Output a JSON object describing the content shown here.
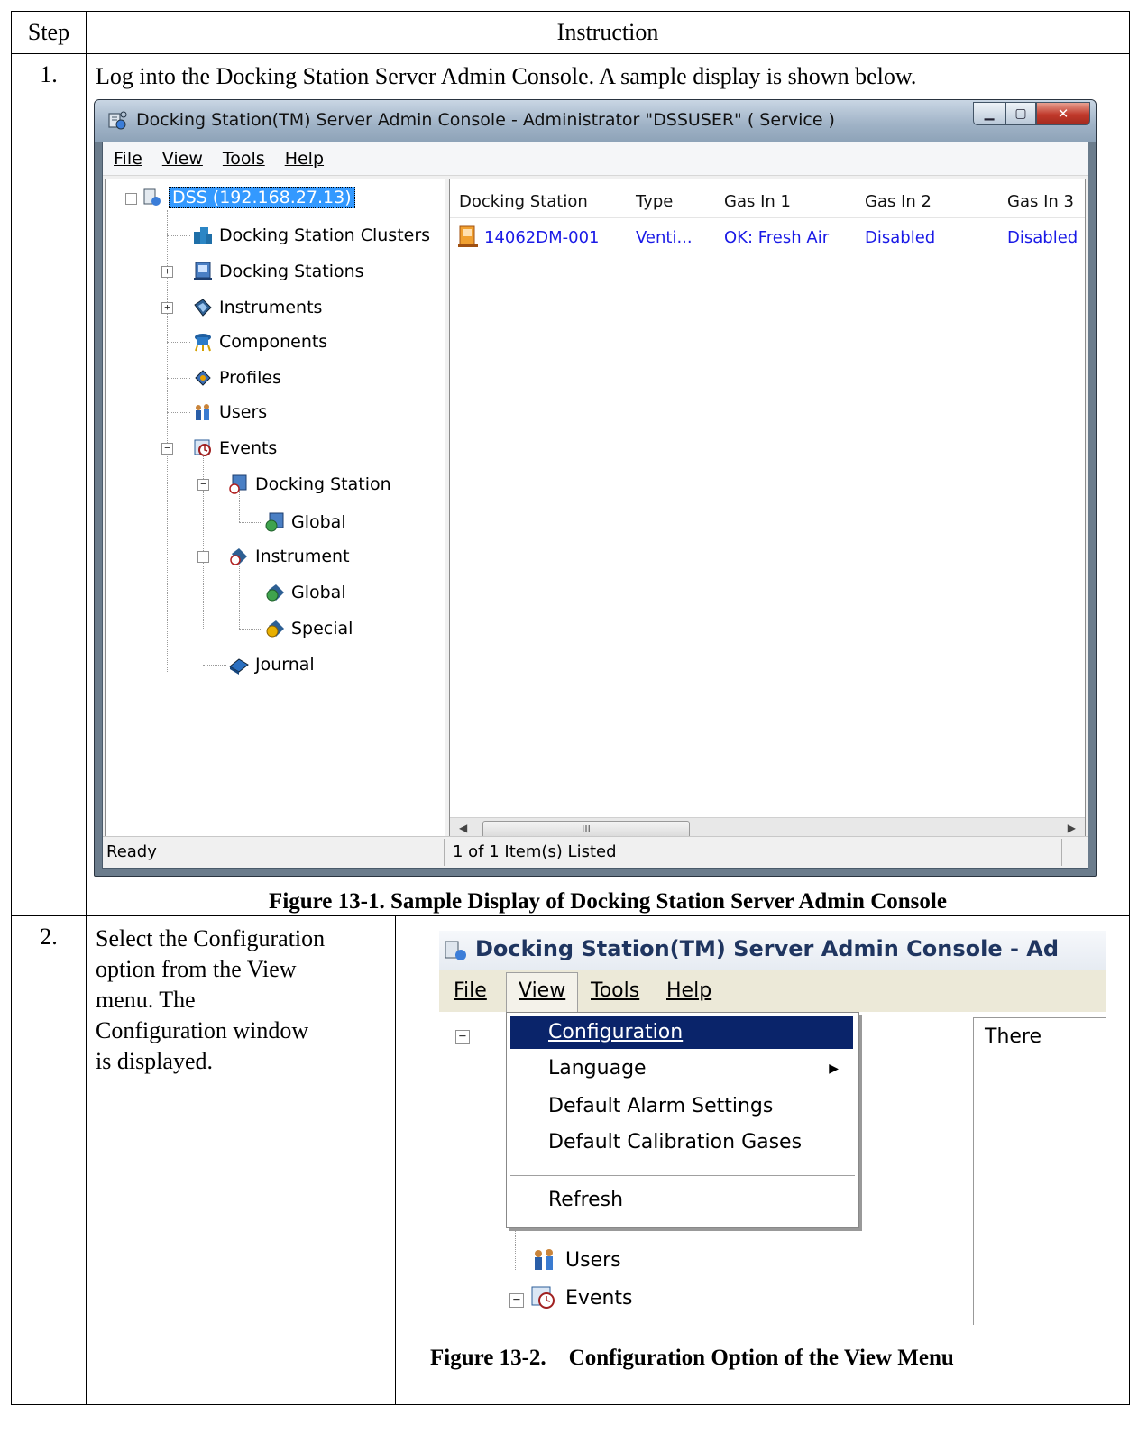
{
  "table": {
    "header_step": "Step",
    "header_instruction": "Instruction"
  },
  "step1": {
    "number": "1.",
    "text": "Log into the Docking Station Server Admin Console.  A sample display is shown below.",
    "figure_caption": "Figure 13-1.  Sample Display of Docking Station Server Admin Console"
  },
  "console": {
    "title": "Docking Station(TM) Server Admin Console - Administrator \"DSSUSER\" ( Service )",
    "menu": [
      "File",
      "View",
      "Tools",
      "Help"
    ],
    "tree": {
      "root": "DSS (192.168.27.13)",
      "clusters": "Docking Station Clusters",
      "docking_stations": "Docking Stations",
      "instruments": "Instruments",
      "components": "Components",
      "profiles": "Profiles",
      "users": "Users",
      "events": "Events",
      "ev_docking_station": "Docking Station",
      "ev_ds_global": "Global",
      "ev_instrument": "Instrument",
      "ev_inst_global": "Global",
      "ev_inst_special": "Special",
      "journal": "Journal"
    },
    "list_columns": [
      "Docking Station",
      "Type",
      "Gas In 1",
      "Gas In 2",
      "Gas In 3"
    ],
    "list_row": [
      "14062DM-001",
      "Venti...",
      "OK: Fresh Air",
      "Disabled",
      "Disabled"
    ],
    "scroll_thumb": "III",
    "status_left": "Ready",
    "status_right": "1 of 1 Item(s) Listed",
    "colors": {
      "selection": "#3399ff",
      "link_text": "#1a1ae6",
      "close_button": "#c0392b"
    }
  },
  "step2": {
    "number": "2.",
    "text_lines": [
      "Select the Configuration",
      "option from the View",
      "menu. The",
      "Configuration window",
      "is displayed."
    ],
    "figure_caption": "Figure 13-2.    Configuration Option of the View Menu"
  },
  "fig2": {
    "title": "Docking Station(TM) Server Admin Console - Ad",
    "menu": [
      "File",
      "View",
      "Tools",
      "Help"
    ],
    "right_pane_text": "There",
    "dropdown": [
      "Configuration",
      "Language",
      "Default Alarm Settings",
      "Default Calibration Gases",
      "Refresh"
    ],
    "tree_users": "Users",
    "tree_events": "Events",
    "colors": {
      "highlight": "#0a246a",
      "title_text": "#1f3560"
    }
  }
}
